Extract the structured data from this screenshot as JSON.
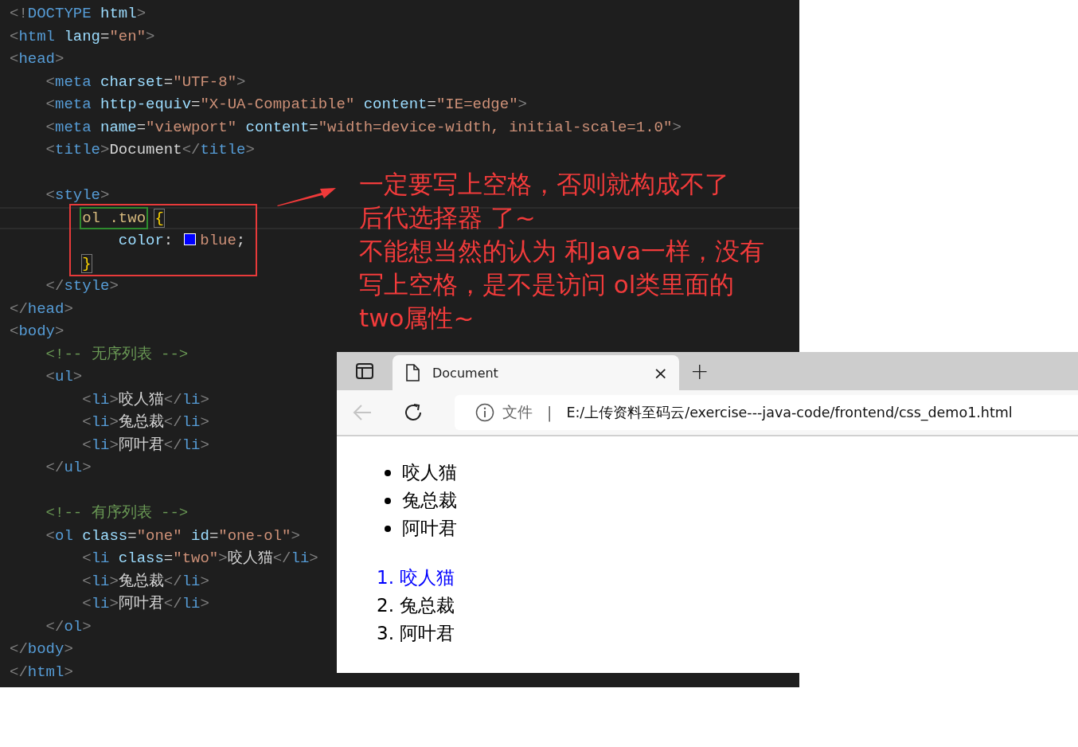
{
  "editor": {
    "lines": [
      {
        "kind": "code",
        "tokens": [
          {
            "kind": "p",
            "text": "<!"
          },
          {
            "kind": "tag",
            "text": "DOCTYPE"
          },
          {
            "kind": "attr",
            "text": " html"
          },
          {
            "kind": "p",
            "text": ">"
          }
        ]
      },
      {
        "kind": "code",
        "tokens": [
          {
            "kind": "p",
            "text": "<"
          },
          {
            "kind": "tag",
            "text": "html"
          },
          {
            "kind": "attr",
            "text": " lang"
          },
          {
            "kind": "t",
            "text": "="
          },
          {
            "kind": "str",
            "text": "\"en\""
          },
          {
            "kind": "p",
            "text": ">"
          }
        ]
      },
      {
        "kind": "code",
        "tokens": [
          {
            "kind": "p",
            "text": "<"
          },
          {
            "kind": "tag",
            "text": "head"
          },
          {
            "kind": "p",
            "text": ">"
          }
        ]
      },
      {
        "kind": "code",
        "tokens": [
          {
            "kind": "p",
            "text": "    <"
          },
          {
            "kind": "tag",
            "text": "meta"
          },
          {
            "kind": "attr",
            "text": " charset"
          },
          {
            "kind": "t",
            "text": "="
          },
          {
            "kind": "str",
            "text": "\"UTF-8\""
          },
          {
            "kind": "p",
            "text": ">"
          }
        ]
      },
      {
        "kind": "code",
        "tokens": [
          {
            "kind": "p",
            "text": "    <"
          },
          {
            "kind": "tag",
            "text": "meta"
          },
          {
            "kind": "attr",
            "text": " http-equiv"
          },
          {
            "kind": "t",
            "text": "="
          },
          {
            "kind": "str",
            "text": "\"X-UA-Compatible\""
          },
          {
            "kind": "attr",
            "text": " content"
          },
          {
            "kind": "t",
            "text": "="
          },
          {
            "kind": "str",
            "text": "\"IE=edge\""
          },
          {
            "kind": "p",
            "text": ">"
          }
        ]
      },
      {
        "kind": "code",
        "tokens": [
          {
            "kind": "p",
            "text": "    <"
          },
          {
            "kind": "tag",
            "text": "meta"
          },
          {
            "kind": "attr",
            "text": " name"
          },
          {
            "kind": "t",
            "text": "="
          },
          {
            "kind": "str",
            "text": "\"viewport\""
          },
          {
            "kind": "attr",
            "text": " content"
          },
          {
            "kind": "t",
            "text": "="
          },
          {
            "kind": "str",
            "text": "\"width=device-width, initial-scale=1.0\""
          },
          {
            "kind": "p",
            "text": ">"
          }
        ]
      },
      {
        "kind": "code",
        "tokens": [
          {
            "kind": "p",
            "text": "    <"
          },
          {
            "kind": "tag",
            "text": "title"
          },
          {
            "kind": "p",
            "text": ">"
          },
          {
            "kind": "t",
            "text": "Document"
          },
          {
            "kind": "p",
            "text": "</"
          },
          {
            "kind": "tag",
            "text": "title"
          },
          {
            "kind": "p",
            "text": ">"
          }
        ]
      },
      {
        "kind": "blank"
      },
      {
        "kind": "code",
        "tokens": [
          {
            "kind": "p",
            "text": "    <"
          },
          {
            "kind": "tag",
            "text": "style"
          },
          {
            "kind": "p",
            "text": ">"
          }
        ]
      },
      {
        "kind": "code",
        "current": true,
        "tokens": [
          {
            "kind": "selbox",
            "text": "        ol .two"
          },
          {
            "kind": "bm",
            "text": " {"
          }
        ]
      },
      {
        "kind": "code",
        "tokens": [
          {
            "kind": "prop",
            "text": "            color"
          },
          {
            "kind": "t",
            "text": ":"
          },
          {
            "kind": "sw",
            "color": "#0000ff"
          },
          {
            "kind": "str",
            "text": "blue"
          },
          {
            "kind": "t",
            "text": ";"
          }
        ]
      },
      {
        "kind": "code",
        "tokens": [
          {
            "kind": "bm",
            "text": "        }"
          }
        ]
      },
      {
        "kind": "code",
        "tokens": [
          {
            "kind": "p",
            "text": "    </"
          },
          {
            "kind": "tag",
            "text": "style"
          },
          {
            "kind": "p",
            "text": ">"
          }
        ]
      },
      {
        "kind": "code",
        "tokens": [
          {
            "kind": "p",
            "text": "</"
          },
          {
            "kind": "tag",
            "text": "head"
          },
          {
            "kind": "p",
            "text": ">"
          }
        ]
      },
      {
        "kind": "code",
        "tokens": [
          {
            "kind": "p",
            "text": "<"
          },
          {
            "kind": "tag",
            "text": "body"
          },
          {
            "kind": "p",
            "text": ">"
          }
        ]
      },
      {
        "kind": "code",
        "tokens": [
          {
            "kind": "c",
            "text": "    <!-- 无序列表 -->"
          }
        ]
      },
      {
        "kind": "code",
        "tokens": [
          {
            "kind": "p",
            "text": "    <"
          },
          {
            "kind": "tag",
            "text": "ul"
          },
          {
            "kind": "p",
            "text": ">"
          }
        ]
      },
      {
        "kind": "code",
        "tokens": [
          {
            "kind": "p",
            "text": "        <"
          },
          {
            "kind": "tag",
            "text": "li"
          },
          {
            "kind": "p",
            "text": ">"
          },
          {
            "kind": "t",
            "text": "咬人猫"
          },
          {
            "kind": "p",
            "text": "</"
          },
          {
            "kind": "tag",
            "text": "li"
          },
          {
            "kind": "p",
            "text": ">"
          }
        ]
      },
      {
        "kind": "code",
        "tokens": [
          {
            "kind": "p",
            "text": "        <"
          },
          {
            "kind": "tag",
            "text": "li"
          },
          {
            "kind": "p",
            "text": ">"
          },
          {
            "kind": "t",
            "text": "兔总裁"
          },
          {
            "kind": "p",
            "text": "</"
          },
          {
            "kind": "tag",
            "text": "li"
          },
          {
            "kind": "p",
            "text": ">"
          }
        ]
      },
      {
        "kind": "code",
        "tokens": [
          {
            "kind": "p",
            "text": "        <"
          },
          {
            "kind": "tag",
            "text": "li"
          },
          {
            "kind": "p",
            "text": ">"
          },
          {
            "kind": "t",
            "text": "阿叶君"
          },
          {
            "kind": "p",
            "text": "</"
          },
          {
            "kind": "tag",
            "text": "li"
          },
          {
            "kind": "p",
            "text": ">"
          }
        ]
      },
      {
        "kind": "code",
        "tokens": [
          {
            "kind": "p",
            "text": "    </"
          },
          {
            "kind": "tag",
            "text": "ul"
          },
          {
            "kind": "p",
            "text": ">"
          }
        ]
      },
      {
        "kind": "blank"
      },
      {
        "kind": "code",
        "tokens": [
          {
            "kind": "c",
            "text": "    <!-- 有序列表 -->"
          }
        ]
      },
      {
        "kind": "code",
        "tokens": [
          {
            "kind": "p",
            "text": "    <"
          },
          {
            "kind": "tag",
            "text": "ol"
          },
          {
            "kind": "attr",
            "text": " class"
          },
          {
            "kind": "t",
            "text": "="
          },
          {
            "kind": "str",
            "text": "\"one\""
          },
          {
            "kind": "attr",
            "text": " id"
          },
          {
            "kind": "t",
            "text": "="
          },
          {
            "kind": "str",
            "text": "\"one-ol\""
          },
          {
            "kind": "p",
            "text": ">"
          }
        ]
      },
      {
        "kind": "code",
        "tokens": [
          {
            "kind": "p",
            "text": "        <"
          },
          {
            "kind": "tag",
            "text": "li"
          },
          {
            "kind": "attr",
            "text": " class"
          },
          {
            "kind": "t",
            "text": "="
          },
          {
            "kind": "str",
            "text": "\"two\""
          },
          {
            "kind": "p",
            "text": ">"
          },
          {
            "kind": "t",
            "text": "咬人猫"
          },
          {
            "kind": "p",
            "text": "</"
          },
          {
            "kind": "tag",
            "text": "li"
          },
          {
            "kind": "p",
            "text": ">"
          }
        ]
      },
      {
        "kind": "code",
        "tokens": [
          {
            "kind": "p",
            "text": "        <"
          },
          {
            "kind": "tag",
            "text": "li"
          },
          {
            "kind": "p",
            "text": ">"
          },
          {
            "kind": "t",
            "text": "兔总裁"
          },
          {
            "kind": "p",
            "text": "</"
          },
          {
            "kind": "tag",
            "text": "li"
          },
          {
            "kind": "p",
            "text": ">"
          }
        ]
      },
      {
        "kind": "code",
        "tokens": [
          {
            "kind": "p",
            "text": "        <"
          },
          {
            "kind": "tag",
            "text": "li"
          },
          {
            "kind": "p",
            "text": ">"
          },
          {
            "kind": "t",
            "text": "阿叶君"
          },
          {
            "kind": "p",
            "text": "</"
          },
          {
            "kind": "tag",
            "text": "li"
          },
          {
            "kind": "p",
            "text": ">"
          }
        ]
      },
      {
        "kind": "code",
        "tokens": [
          {
            "kind": "p",
            "text": "    </"
          },
          {
            "kind": "tag",
            "text": "ol"
          },
          {
            "kind": "p",
            "text": ">"
          }
        ]
      },
      {
        "kind": "code",
        "tokens": [
          {
            "kind": "p",
            "text": "</"
          },
          {
            "kind": "tag",
            "text": "body"
          },
          {
            "kind": "p",
            "text": ">"
          }
        ]
      },
      {
        "kind": "code",
        "tokens": [
          {
            "kind": "p",
            "text": "</"
          },
          {
            "kind": "tag",
            "text": "html"
          },
          {
            "kind": "p",
            "text": ">"
          }
        ]
      }
    ]
  },
  "annotation": {
    "lines": [
      "一定要写上空格，否则就构成不了",
      "后代选择器 了~",
      "不能想当然的认为 和Java一样，没有",
      "写上空格，是不是访问 ol类里面的",
      "two属性~"
    ]
  },
  "browser": {
    "tab": {
      "title": "Document",
      "close": "×",
      "selected": true
    },
    "new_tab": "+",
    "back_disabled": true,
    "address": {
      "label": "文件",
      "separator": "|",
      "url": "E:/上传资料至码云/exercise---java-code/frontend/css_demo1.html"
    },
    "unordered_list": [
      {
        "text": "咬人猫"
      },
      {
        "text": "兔总裁"
      },
      {
        "text": "阿叶君"
      }
    ],
    "ordered_list": [
      {
        "text": "1. 咬人猫",
        "color": "#0000ff"
      },
      {
        "text": "2. 兔总裁",
        "color": "#000000"
      },
      {
        "text": "3. 阿叶君",
        "color": "#000000"
      }
    ]
  }
}
